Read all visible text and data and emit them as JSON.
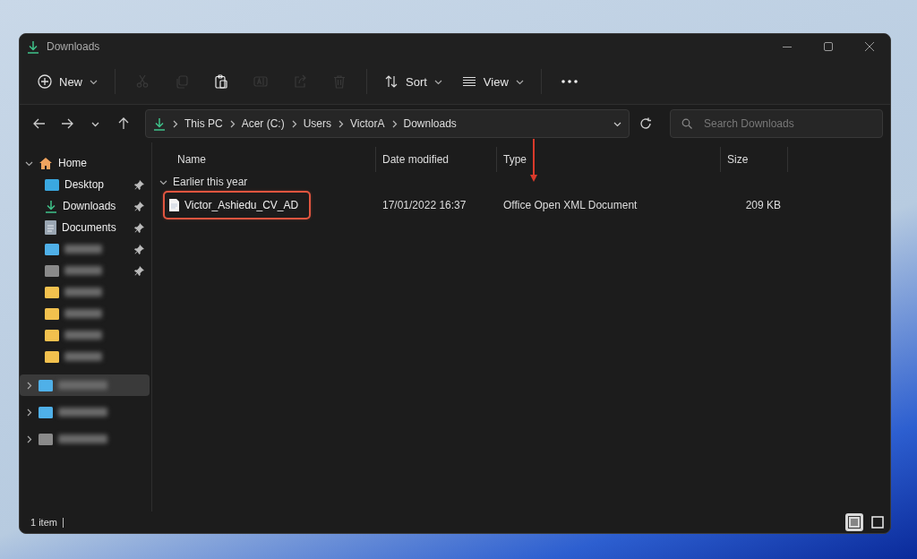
{
  "window": {
    "title": "Downloads"
  },
  "toolbar": {
    "items": [
      {
        "kind": "labeled",
        "label": "New",
        "disabled": false
      },
      {
        "kind": "icon",
        "disabled": true
      },
      {
        "kind": "icon",
        "disabled": true
      },
      {
        "kind": "icon",
        "disabled": false
      },
      {
        "kind": "icon",
        "disabled": true
      },
      {
        "kind": "icon",
        "disabled": true
      },
      {
        "kind": "icon",
        "disabled": true
      },
      {
        "kind": "labeled",
        "label": "Sort",
        "disabled": false
      },
      {
        "kind": "labeled",
        "label": "View",
        "disabled": false
      },
      {
        "kind": "icon",
        "disabled": false
      }
    ]
  },
  "address": {
    "segments": [
      "This PC",
      "Acer (C:)",
      "Users",
      "VictorA",
      "Downloads"
    ]
  },
  "search": {
    "placeholder": "Search Downloads"
  },
  "sidebar": {
    "items": [
      {
        "kind": "named",
        "label": "Home",
        "expanded": true,
        "selected": false,
        "children": [
          {
            "kind": "named",
            "label": "Desktop",
            "pinned": true
          },
          {
            "kind": "named",
            "label": "Downloads",
            "pinned": true
          },
          {
            "kind": "named",
            "label": "Documents",
            "pinned": true
          },
          {
            "kind": "redacted",
            "color": "#4fb0e8",
            "pinned": true
          },
          {
            "kind": "redacted",
            "color": "#8a8a8a",
            "pinned": true
          },
          {
            "kind": "redacted",
            "color": "#f2c14e",
            "pinned": false
          },
          {
            "kind": "redacted",
            "color": "#f2c14e",
            "pinned": false
          },
          {
            "kind": "redacted",
            "color": "#f2c14e",
            "pinned": false
          },
          {
            "kind": "redacted",
            "color": "#f2c14e",
            "pinned": false
          }
        ]
      },
      {
        "kind": "redacted",
        "color": "#4fb0e8",
        "expanded": false,
        "selected": true
      },
      {
        "kind": "redacted",
        "color": "#4fb0e8",
        "expanded": false,
        "selected": false
      },
      {
        "kind": "redacted",
        "color": "#8a8a8a",
        "expanded": false,
        "selected": false
      }
    ]
  },
  "table": {
    "columns": [
      {
        "label": "Name",
        "marked": false
      },
      {
        "label": "Date modified",
        "marked": false
      },
      {
        "label": "Type",
        "marked": true
      },
      {
        "label": "Size",
        "marked": false
      }
    ],
    "group": {
      "label": "Earlier this year",
      "expanded": true
    },
    "rows": [
      {
        "name": "Victor_Ashiedu_CV_AD",
        "date": "17/01/2022 16:37",
        "type": "Office Open XML Document",
        "size": "209 KB",
        "highlighted": true
      }
    ]
  },
  "status_bar": {
    "count": "1 item",
    "views": [
      {
        "kind": "details",
        "selected": true
      },
      {
        "kind": "tiles",
        "selected": false
      }
    ]
  }
}
